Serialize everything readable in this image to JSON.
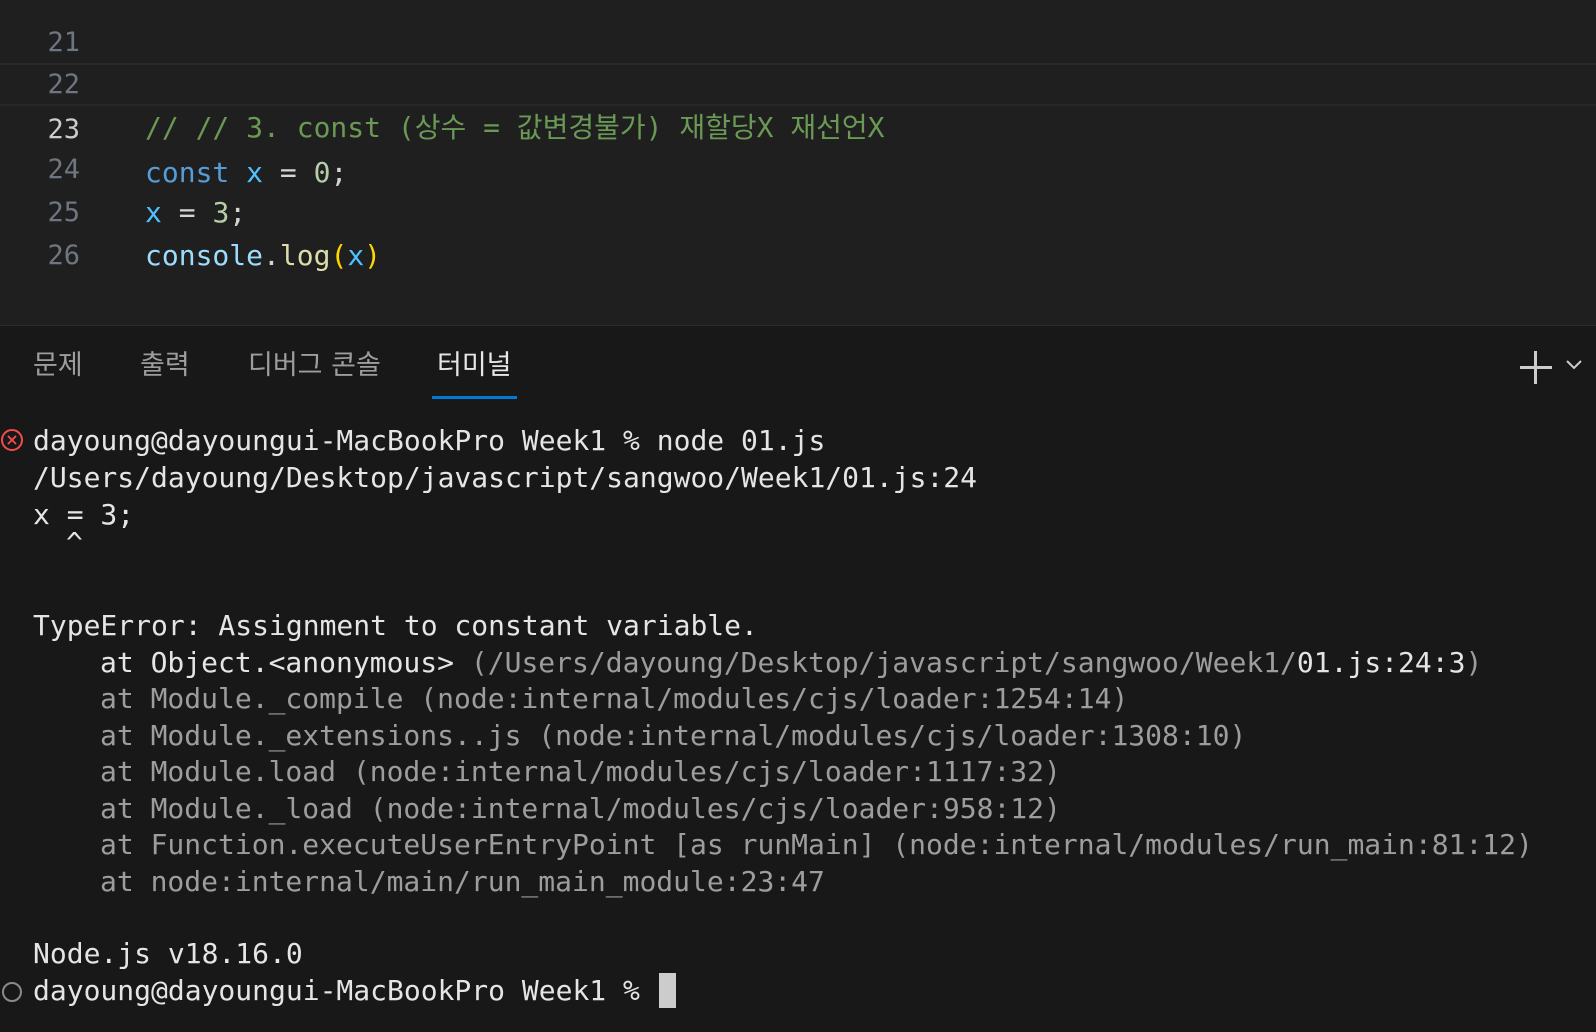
{
  "editor": {
    "lines": [
      {
        "number": "21",
        "text": ""
      },
      {
        "number": "22",
        "text": "// // 3. const (상수 = 값변경불가) 재할당X 재선언X"
      },
      {
        "number": "23",
        "kw": "const",
        "var": "x",
        "rest": " = ",
        "num": "0",
        "end": ";"
      },
      {
        "number": "24",
        "var": "x",
        "rest": " = ",
        "num": "3",
        "end": ";"
      },
      {
        "number": "25",
        "obj": "console",
        "dot": ".",
        "fn": "log",
        "open": "(",
        "arg": "x",
        "close": ")"
      },
      {
        "number": "26",
        "text": ""
      }
    ]
  },
  "panel": {
    "tabs": [
      {
        "label": "문제"
      },
      {
        "label": "출력"
      },
      {
        "label": "디버그 콘솔"
      },
      {
        "label": "터미널"
      }
    ],
    "active_tab": "터미널",
    "actions": {
      "new_terminal": "plus-icon",
      "dropdown": "chevron-down-icon"
    }
  },
  "terminal": {
    "prompt1": "dayoung@dayoungui-MacBookPro Week1 % node 01.js",
    "file_line": "/Users/dayoung/Desktop/javascript/sangwoo/Week1/01.js:24",
    "code_line": "x = 3;",
    "caret": "^",
    "error": "TypeError: Assignment to constant variable.",
    "stack_first_at": "at Object.<anonymous> ",
    "stack_first_path": "(/Users/dayoung/Desktop/javascript/sangwoo/Week1/",
    "stack_first_file": "01.js:24:3",
    "stack_first_close": ")",
    "stack": [
      "at Module._compile (node:internal/modules/cjs/loader:1254:14)",
      "at Module._extensions..js (node:internal/modules/cjs/loader:1308:10)",
      "at Module.load (node:internal/modules/cjs/loader:1117:32)",
      "at Module._load (node:internal/modules/cjs/loader:958:12)",
      "at Function.executeUserEntryPoint [as runMain] (node:internal/modules/run_main:81:12)",
      "at node:internal/main/run_main_module:23:47"
    ],
    "node_version": "Node.js v18.16.0",
    "prompt2": "dayoung@dayoungui-MacBookPro Week1 % ",
    "status_icons": {
      "failed": "error-circle-icon",
      "idle": "circle-icon"
    },
    "colors": {
      "error": "#f14c4c",
      "tab_active_underline": "#0078d4"
    }
  }
}
